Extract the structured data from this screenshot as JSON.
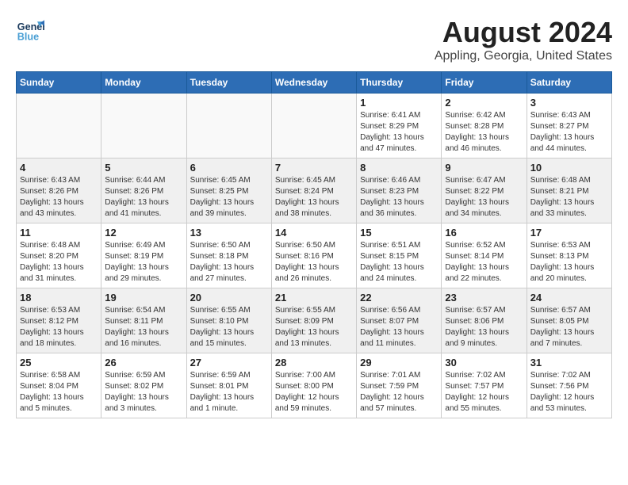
{
  "header": {
    "logo_line1": "General",
    "logo_line2": "Blue",
    "main_title": "August 2024",
    "subtitle": "Appling, Georgia, United States"
  },
  "weekdays": [
    "Sunday",
    "Monday",
    "Tuesday",
    "Wednesday",
    "Thursday",
    "Friday",
    "Saturday"
  ],
  "weeks": [
    [
      {
        "day": "",
        "info": ""
      },
      {
        "day": "",
        "info": ""
      },
      {
        "day": "",
        "info": ""
      },
      {
        "day": "",
        "info": ""
      },
      {
        "day": "1",
        "info": "Sunrise: 6:41 AM\nSunset: 8:29 PM\nDaylight: 13 hours\nand 47 minutes."
      },
      {
        "day": "2",
        "info": "Sunrise: 6:42 AM\nSunset: 8:28 PM\nDaylight: 13 hours\nand 46 minutes."
      },
      {
        "day": "3",
        "info": "Sunrise: 6:43 AM\nSunset: 8:27 PM\nDaylight: 13 hours\nand 44 minutes."
      }
    ],
    [
      {
        "day": "4",
        "info": "Sunrise: 6:43 AM\nSunset: 8:26 PM\nDaylight: 13 hours\nand 43 minutes."
      },
      {
        "day": "5",
        "info": "Sunrise: 6:44 AM\nSunset: 8:26 PM\nDaylight: 13 hours\nand 41 minutes."
      },
      {
        "day": "6",
        "info": "Sunrise: 6:45 AM\nSunset: 8:25 PM\nDaylight: 13 hours\nand 39 minutes."
      },
      {
        "day": "7",
        "info": "Sunrise: 6:45 AM\nSunset: 8:24 PM\nDaylight: 13 hours\nand 38 minutes."
      },
      {
        "day": "8",
        "info": "Sunrise: 6:46 AM\nSunset: 8:23 PM\nDaylight: 13 hours\nand 36 minutes."
      },
      {
        "day": "9",
        "info": "Sunrise: 6:47 AM\nSunset: 8:22 PM\nDaylight: 13 hours\nand 34 minutes."
      },
      {
        "day": "10",
        "info": "Sunrise: 6:48 AM\nSunset: 8:21 PM\nDaylight: 13 hours\nand 33 minutes."
      }
    ],
    [
      {
        "day": "11",
        "info": "Sunrise: 6:48 AM\nSunset: 8:20 PM\nDaylight: 13 hours\nand 31 minutes."
      },
      {
        "day": "12",
        "info": "Sunrise: 6:49 AM\nSunset: 8:19 PM\nDaylight: 13 hours\nand 29 minutes."
      },
      {
        "day": "13",
        "info": "Sunrise: 6:50 AM\nSunset: 8:18 PM\nDaylight: 13 hours\nand 27 minutes."
      },
      {
        "day": "14",
        "info": "Sunrise: 6:50 AM\nSunset: 8:16 PM\nDaylight: 13 hours\nand 26 minutes."
      },
      {
        "day": "15",
        "info": "Sunrise: 6:51 AM\nSunset: 8:15 PM\nDaylight: 13 hours\nand 24 minutes."
      },
      {
        "day": "16",
        "info": "Sunrise: 6:52 AM\nSunset: 8:14 PM\nDaylight: 13 hours\nand 22 minutes."
      },
      {
        "day": "17",
        "info": "Sunrise: 6:53 AM\nSunset: 8:13 PM\nDaylight: 13 hours\nand 20 minutes."
      }
    ],
    [
      {
        "day": "18",
        "info": "Sunrise: 6:53 AM\nSunset: 8:12 PM\nDaylight: 13 hours\nand 18 minutes."
      },
      {
        "day": "19",
        "info": "Sunrise: 6:54 AM\nSunset: 8:11 PM\nDaylight: 13 hours\nand 16 minutes."
      },
      {
        "day": "20",
        "info": "Sunrise: 6:55 AM\nSunset: 8:10 PM\nDaylight: 13 hours\nand 15 minutes."
      },
      {
        "day": "21",
        "info": "Sunrise: 6:55 AM\nSunset: 8:09 PM\nDaylight: 13 hours\nand 13 minutes."
      },
      {
        "day": "22",
        "info": "Sunrise: 6:56 AM\nSunset: 8:07 PM\nDaylight: 13 hours\nand 11 minutes."
      },
      {
        "day": "23",
        "info": "Sunrise: 6:57 AM\nSunset: 8:06 PM\nDaylight: 13 hours\nand 9 minutes."
      },
      {
        "day": "24",
        "info": "Sunrise: 6:57 AM\nSunset: 8:05 PM\nDaylight: 13 hours\nand 7 minutes."
      }
    ],
    [
      {
        "day": "25",
        "info": "Sunrise: 6:58 AM\nSunset: 8:04 PM\nDaylight: 13 hours\nand 5 minutes."
      },
      {
        "day": "26",
        "info": "Sunrise: 6:59 AM\nSunset: 8:02 PM\nDaylight: 13 hours\nand 3 minutes."
      },
      {
        "day": "27",
        "info": "Sunrise: 6:59 AM\nSunset: 8:01 PM\nDaylight: 13 hours\nand 1 minute."
      },
      {
        "day": "28",
        "info": "Sunrise: 7:00 AM\nSunset: 8:00 PM\nDaylight: 12 hours\nand 59 minutes."
      },
      {
        "day": "29",
        "info": "Sunrise: 7:01 AM\nSunset: 7:59 PM\nDaylight: 12 hours\nand 57 minutes."
      },
      {
        "day": "30",
        "info": "Sunrise: 7:02 AM\nSunset: 7:57 PM\nDaylight: 12 hours\nand 55 minutes."
      },
      {
        "day": "31",
        "info": "Sunrise: 7:02 AM\nSunset: 7:56 PM\nDaylight: 12 hours\nand 53 minutes."
      }
    ]
  ]
}
